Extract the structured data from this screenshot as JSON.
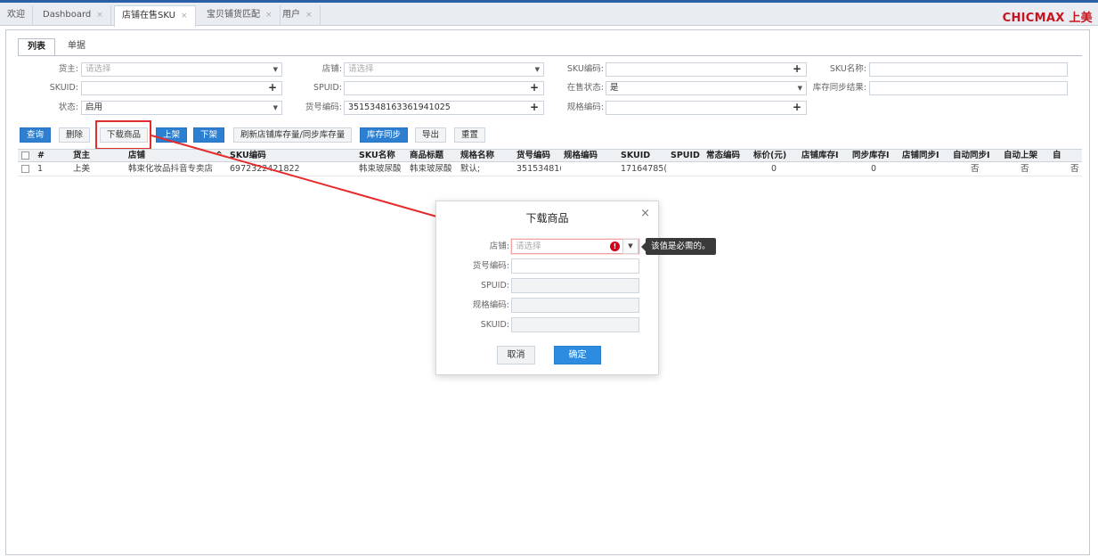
{
  "tabs": [
    {
      "label": "欢迎",
      "closable": false
    },
    {
      "label": "Dashboard",
      "closable": true
    },
    {
      "label": "店铺在售SKU",
      "closable": true
    },
    {
      "label": "宝贝铺货匹配",
      "closable": true
    },
    {
      "label": "用户",
      "closable": true
    }
  ],
  "close_glyph": "×",
  "brand": "CHICMAX 上美",
  "subtabs": [
    "列表",
    "单据"
  ],
  "filters": {
    "owner_label": "货主:",
    "owner_placeholder": "请选择",
    "shop_label": "店铺:",
    "shop_placeholder": "请选择",
    "skucode_label": "SKU编码:",
    "skuname_label": "SKU名称:",
    "skuid_label": "SKUID:",
    "spuid_label": "SPUID:",
    "onsale_label": "在售状态:",
    "onsale_value": "是",
    "sync_label": "库存同步结果:",
    "status_label": "状态:",
    "status_value": "启用",
    "itemno_label": "货号编码:",
    "itemno_value": "3515348163361941025",
    "spec_label": "规格编码:"
  },
  "toolbar": [
    "查询",
    "删除",
    "下载商品",
    "上架",
    "下架",
    "刷新店铺库存量/同步库存量",
    "库存同步",
    "导出",
    "重置"
  ],
  "grid": {
    "headers": [
      "#",
      "货主",
      "店铺",
      "SKU编码",
      "SKU名称",
      "商品标题",
      "规格名称",
      "货号编码",
      "规格编码",
      "SKUID",
      "SPUID",
      "常态编码",
      "标价(元)",
      "店铺库存I",
      "同步库存I",
      "店铺同步I",
      "自动同步I",
      "自动上架",
      "自"
    ],
    "sort_glyph": "^",
    "row": [
      "1",
      "上美",
      "韩束化妆品抖音专卖店",
      "6972322421822",
      "韩束玻尿酸",
      "韩束玻尿酸",
      "默认;",
      "35153481(",
      "",
      "17164785(",
      "",
      "",
      "0",
      "",
      "0",
      "",
      "否",
      "否",
      "否"
    ]
  },
  "dialog": {
    "title": "下载商品",
    "close": "×",
    "fields": [
      {
        "label": "店铺:",
        "placeholder": "请选择"
      },
      {
        "label": "货号编码:"
      },
      {
        "label": "SPUID:"
      },
      {
        "label": "规格编码:"
      },
      {
        "label": "SKUID:"
      }
    ],
    "error_tooltip": "该值是必需的。",
    "error_mark": "!",
    "cancel": "取消",
    "ok": "确定"
  },
  "colors": {
    "accent": "#2d7fd2",
    "highlight": "#e52b2b",
    "brand": "#c8141e"
  }
}
